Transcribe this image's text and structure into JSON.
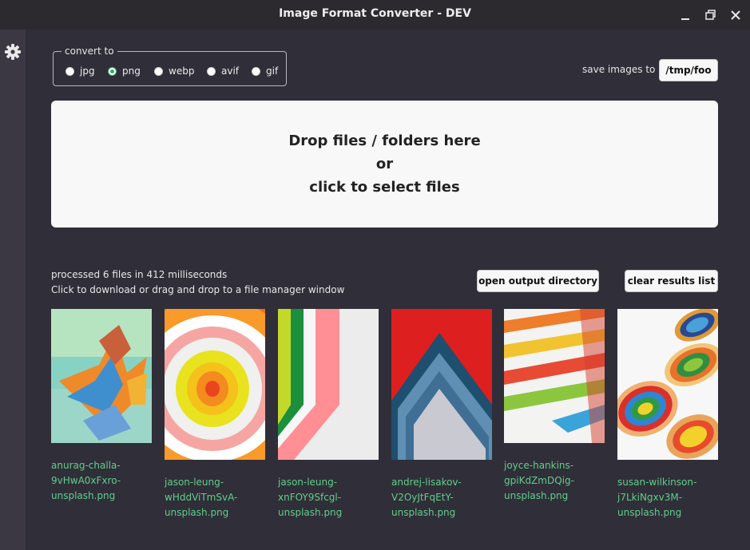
{
  "window": {
    "title": "Image Format Converter - DEV"
  },
  "convert": {
    "legend": "convert to",
    "options": [
      "jpg",
      "png",
      "webp",
      "avif",
      "gif"
    ],
    "selected": "png"
  },
  "output": {
    "save_label": "save images to",
    "path": "/tmp/foo"
  },
  "dropzone": {
    "line1": "Drop files / folders here",
    "line2": "or",
    "line3": "click to select files"
  },
  "results": {
    "status": "processed 6 files in 412 milliseconds",
    "hint": "Click to download or drag and drop to a file manager window",
    "open_dir_label": "open output directory",
    "clear_label": "clear results list",
    "files": [
      {
        "caption": [
          "anurag-challa-",
          "9vHwA0xFxro-",
          "unsplash.png"
        ]
      },
      {
        "caption": [
          "jason-leung-",
          "wHddViTmSvA-",
          "unsplash.png"
        ]
      },
      {
        "caption": [
          "jason-leung-",
          "xnFOY9Sfcgl-",
          "unsplash.png"
        ]
      },
      {
        "caption": [
          "andrej-lisakov-",
          "V2OyJtFqEtY-",
          "unsplash.png"
        ]
      },
      {
        "caption": [
          "joyce-hankins-",
          "gpiKdZmDQig-",
          "unsplash.png"
        ]
      },
      {
        "caption": [
          "susan-wilkinson-",
          "j7LkiNgxv3M-",
          "unsplash.png"
        ]
      }
    ]
  },
  "colors": {
    "accent": "#2fae6c",
    "caption": "#5fd08a",
    "background": "#302e38"
  }
}
